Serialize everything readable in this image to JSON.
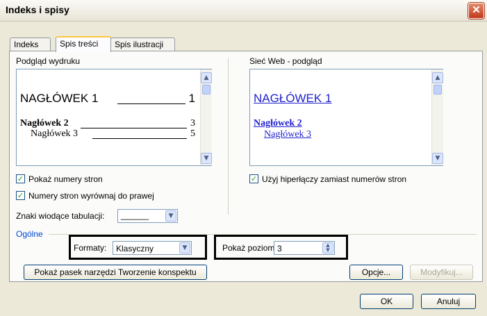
{
  "window": {
    "title": "Indeks i spisy",
    "close_symbol": "✕"
  },
  "tabs": [
    {
      "label": "Indeks",
      "active": false
    },
    {
      "label": "Spis treści",
      "active": true
    },
    {
      "label": "Spis ilustracji",
      "active": false
    }
  ],
  "print_preview": {
    "label": "Podgląd wydruku",
    "heading1": "NAGŁÓWEK 1",
    "heading1_page": "1",
    "heading2": "Nagłówek 2",
    "heading2_page": "3",
    "heading3": "Nagłówek 3",
    "heading3_page": "5"
  },
  "web_preview": {
    "label": "Sieć Web - podgląd",
    "heading1": "NAGŁÓWEK 1",
    "heading2": "Nagłówek 2",
    "heading3": "Nagłówek 3",
    "link_color": "#1f1fcc"
  },
  "options": {
    "show_page_numbers": "Pokaż numery stron",
    "align_page_numbers": "Numery stron wyrównaj do prawej",
    "tab_leader_label": "Znaki wiodące tabulacji:",
    "tab_leader_value": "______",
    "use_hyperlinks": "Użyj hiperłączy zamiast numerów stron"
  },
  "general": {
    "label": "Ogólne",
    "formats_label": "Formaty:",
    "formats_value": "Klasyczny",
    "levels_label": "Pokaż poziomy:",
    "levels_value": "3"
  },
  "buttons": {
    "outline_toolbar": "Pokaż pasek narzędzi Tworzenie konspektu",
    "options": "Opcje...",
    "modify": "Modyfikuj...",
    "ok": "OK",
    "cancel": "Anuluj"
  }
}
